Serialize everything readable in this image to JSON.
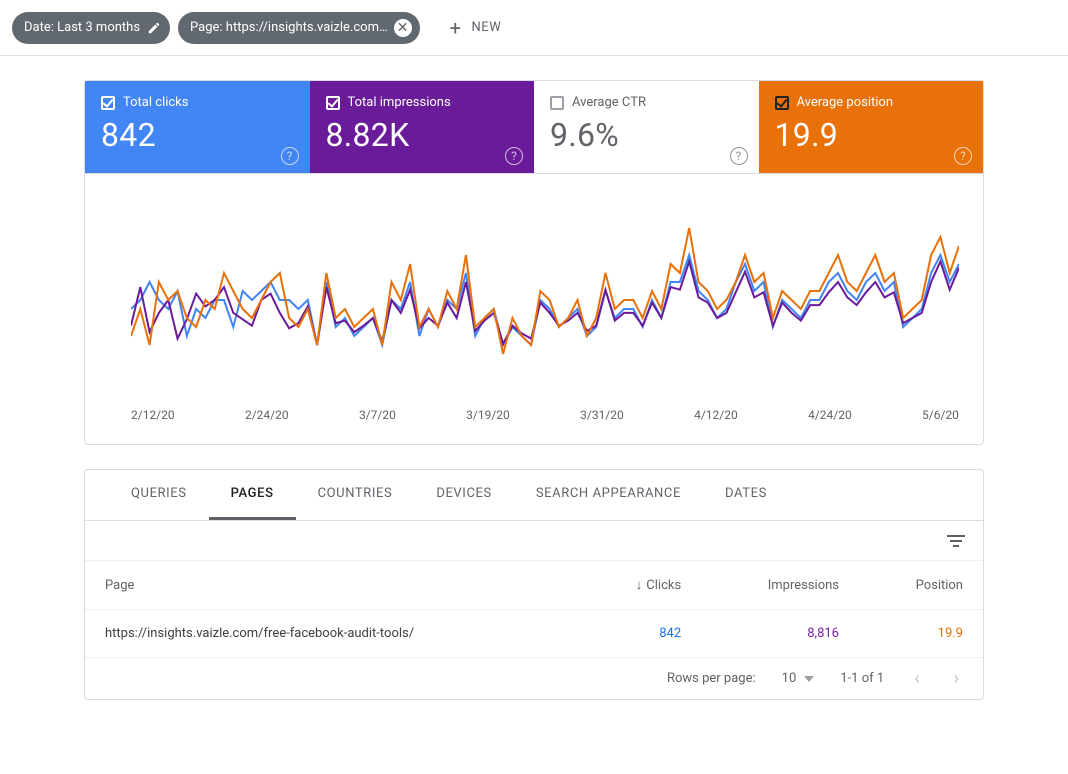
{
  "filters": {
    "date_chip": "Date: Last 3 months",
    "page_chip": "Page: https://insights.vaizle.com…",
    "new_label": "NEW"
  },
  "metrics": {
    "clicks": {
      "label": "Total clicks",
      "value": "842",
      "selected": true
    },
    "impressions": {
      "label": "Total impressions",
      "value": "8.82K",
      "selected": true
    },
    "ctr": {
      "label": "Average CTR",
      "value": "9.6%",
      "selected": false
    },
    "position": {
      "label": "Average position",
      "value": "19.9",
      "selected": true
    }
  },
  "colors": {
    "clicks": "#4285f4",
    "impressions": "#6a1b9a",
    "position": "#e8710a",
    "ctr_text": "#5f6368"
  },
  "chart_data": {
    "type": "line",
    "x_ticks": [
      "2/12/20",
      "2/24/20",
      "3/7/20",
      "3/19/20",
      "3/31/20",
      "4/12/20",
      "4/24/20",
      "5/6/20"
    ],
    "note": "Shared x-axis of ~90 daily points spanning 2020-02-12 to 2020-05-06. Y values are approximate (read from un-labeled axes). Clicks & Impressions share a common relative scale; Position is inverted (lower = better).",
    "series": [
      {
        "name": "Total clicks",
        "color": "#4285f4",
        "values": [
          9,
          10,
          12,
          10,
          9,
          11,
          6,
          9,
          8,
          10,
          10,
          7,
          11,
          10,
          11,
          12,
          10,
          10,
          9,
          10,
          5,
          12,
          7,
          8,
          6,
          7,
          8,
          5,
          10,
          9,
          12,
          6,
          9,
          7,
          10,
          9,
          13,
          6,
          8,
          9,
          5,
          7,
          6,
          5,
          10,
          9,
          7,
          8,
          9,
          6,
          7,
          11,
          8,
          9,
          9,
          7,
          10,
          8,
          12,
          12,
          15,
          11,
          10,
          8,
          9,
          12,
          14,
          11,
          12,
          7,
          10,
          9,
          8,
          10,
          10,
          12,
          13,
          11,
          10,
          12,
          13,
          11,
          12,
          7,
          8,
          9,
          13,
          15,
          12,
          14
        ]
      },
      {
        "name": "Total impressions",
        "color": "#6a1b9a",
        "values": [
          90,
          120,
          85,
          100,
          110,
          80,
          95,
          115,
          105,
          110,
          120,
          100,
          95,
          90,
          110,
          115,
          100,
          88,
          92,
          105,
          75,
          120,
          92,
          94,
          85,
          90,
          96,
          78,
          110,
          100,
          118,
          88,
          96,
          90,
          108,
          96,
          124,
          86,
          94,
          100,
          76,
          90,
          84,
          80,
          108,
          100,
          90,
          94,
          100,
          86,
          90,
          118,
          94,
          100,
          100,
          90,
          108,
          96,
          120,
          118,
          140,
          112,
          108,
          96,
          100,
          116,
          132,
          112,
          116,
          90,
          108,
          100,
          94,
          106,
          106,
          116,
          124,
          112,
          106,
          116,
          124,
          112,
          116,
          92,
          96,
          100,
          124,
          140,
          118,
          135
        ]
      },
      {
        "name": "Average position",
        "color": "#e8710a",
        "values": [
          24,
          21,
          25,
          18,
          20,
          19,
          22,
          23,
          20,
          21,
          17,
          19,
          21,
          22,
          20,
          18,
          17,
          22,
          23,
          21,
          25,
          17,
          22,
          21,
          23,
          22,
          21,
          25,
          18,
          20,
          16,
          23,
          21,
          23,
          19,
          21,
          15,
          23,
          22,
          21,
          26,
          22,
          24,
          25,
          19,
          20,
          23,
          22,
          20,
          24,
          22,
          17,
          21,
          20,
          20,
          22,
          19,
          21,
          16,
          17,
          12,
          18,
          19,
          21,
          20,
          18,
          15,
          18,
          17,
          22,
          19,
          20,
          21,
          19,
          19,
          17,
          15,
          18,
          19,
          17,
          15,
          18,
          17,
          22,
          21,
          20,
          15,
          13,
          17,
          14
        ]
      }
    ]
  },
  "tabs": [
    "QUERIES",
    "PAGES",
    "COUNTRIES",
    "DEVICES",
    "SEARCH APPEARANCE",
    "DATES"
  ],
  "active_tab": "PAGES",
  "table": {
    "headers": {
      "page": "Page",
      "clicks": "Clicks",
      "impressions": "Impressions",
      "position": "Position"
    },
    "sort_by": "clicks",
    "rows": [
      {
        "page": "https://insights.vaizle.com/free-facebook-audit-tools/",
        "clicks": "842",
        "impressions": "8,816",
        "position": "19.9"
      }
    ]
  },
  "paginator": {
    "rows_label": "Rows per page:",
    "rows_value": "10",
    "range": "1-1 of 1"
  }
}
